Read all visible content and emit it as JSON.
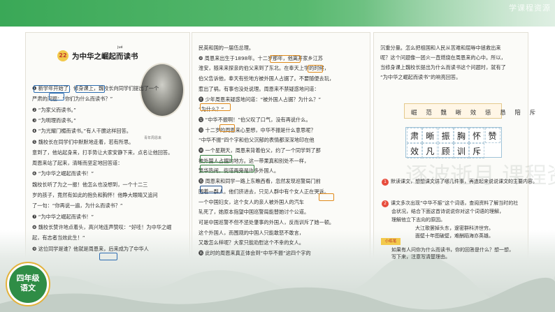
{
  "header": {
    "watermark": "学课程资源"
  },
  "lesson": {
    "number": "22",
    "title": "为中华之崛起而读书",
    "pinyin": "jué",
    "photo_caption": "青年周恩来"
  },
  "left_page": [
    "❶ 新学年开始了，修身课上，魏校长向同学们提出了一个",
    "严肃的问题：“你们为什么而读书？”",
    "❷ “为家父而读书。”",
    "❸ “为明理而读书。”",
    "❹ “为光耀门楣而读书。”有人干脆这样回答。",
    "❺ 魏校长在同学们中默默地走着，若有所思。",
    "意到了，他站起身来，打手势让大家安静下来，点名让他回答。",
    "周恩来站了起来，清晰而坚定地回答道：",
    "❻ “为中华之崛起而读书！”",
    "魏校长听了为之一振！他怎么也没想到，一个十二三",
    "岁的孩子，竟然有如此的抱负和胸怀！他睁大眼睛又追问",
    "了一句：“你再说一遍，为什么而读书？”",
    "❼ “为中华之崛起而读书！”",
    "❽ 魏校长赞许地点着头，高兴地连声赞叹：“好哇！为中华之崛",
    "起，有志者当效此生！”",
    "❾ 这位同学是谁？他就是周恩来，后来成为了中华人"
  ],
  "middle_page": [
    "民英和国的一届伍总理。",
    "❿ 周恩来出生于1898年。十二岁那年，他离开家乡江苏",
    "淮安，随来来探亲的伯父来到了东北。在奉天上学的时候，",
    "伯父告诉他，奉天有些地方被外国人占据了。不要随便去玩，",
    "惹出了祸，有事也没处说理。周恩来不禁疑惑地问道：",
    "⓫ 少年周恩来疑惑地问道：“被外国人占据？为什么？”",
    "“为什么？”",
    "⓬ “中华不振啊！”伯父叹了口气，没有再说什么。",
    "⓭ 十二岁的周恩来心里想，中华不振是什么意思呢？",
    "“中华不振”四个字和伯父沉郁的表情都深深地印在他",
    "⓮ 一个星期天，周恩来背着伯父，约了一个同学到了那",
    "被外国人占据的地方。这一带果真和别处不一样，",
    "繁华热闹，街道两旁是许多外国人。",
    "⓯ 周恩来和同学一路上东瞧西看，忽然发现巡警局门前",
    "围着一群人。他们挤进去，只见人群中有个女人正在哭诉。",
    "一个中国妇女，这个女人的亲人被外国人的汽车",
    "轧死了，她原本指望中国巡警局能替她讨个公道。",
    "可是中国巡警不但不惩处肇事的外国人，反而训斥了她一顿。",
    "这个外国人，而围观的中国人只能敢怒不敢言，",
    "又敢怎么样呢？大家只能劝慰这个不幸的女人。",
    "⓰ 此时的周恩来真正体会到“中华不振”这四个字的"
  ],
  "right_page": {
    "lines": [
      "沉重分量。怎么把祖国和人民从苦难和屈辱中拯救出来",
      "呢？这个问题像一团火一直燃烧在周恩来的心中。所以，",
      "当修身课上魏校长提出为什么而读书这个问题时，就有了",
      "“为中华之崛起而读书”的响亮回答。"
    ],
    "pinyin_row": "崛  范  魏  晰  效  惩  恳  陪  斥",
    "new_chars": [
      "肃",
      "晰",
      "振",
      "胸",
      "怀",
      "赞",
      "效",
      "凡",
      "顾",
      "训",
      "斥"
    ],
    "exercises": [
      {
        "num": "1",
        "text": "默读课文，想想课文讲了哪几件事，再连起来说说课文的主要内容。"
      },
      {
        "num": "2",
        "text": "课文多次出现“中华不振”这个词语，查阅资料了解当时的社"
      },
      {
        "num": "",
        "text": "会状况，结合下面这首诗说说你对这个词语的理解，"
      },
      {
        "num": "",
        "text": "理解他立下志向的原因。"
      },
      {
        "num": "",
        "text": "大江歌罢掉头东，邃密群科济世穷。"
      },
      {
        "num": "",
        "text": "面壁十年图破壁，难酬蹈海亦英雄。"
      }
    ],
    "tip_label": "小练笔",
    "tip_lines": [
      "如果有人问你为什么而读书，你的回答是什么？想一想，",
      "写下来，注意写清楚理由。"
    ]
  },
  "badge": {
    "line1": "四年级",
    "line2": "语文"
  },
  "brush_text": "逐波逝月  课程资源  宝典"
}
